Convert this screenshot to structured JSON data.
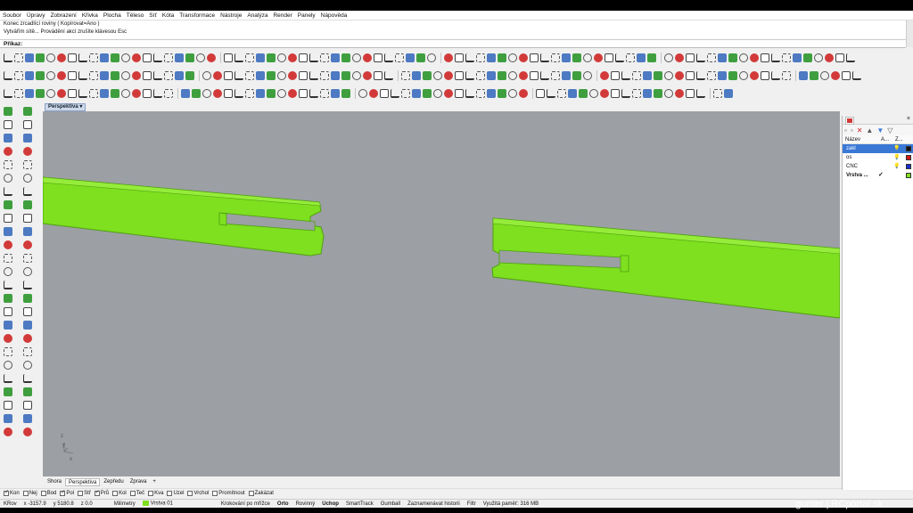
{
  "menu": [
    "Soubor",
    "Úpravy",
    "Zobrazení",
    "Křivka",
    "Plocha",
    "Těleso",
    "Síť",
    "Kóta",
    "Transformace",
    "Nástroje",
    "Analýza",
    "Render",
    "Panely",
    "Nápověda"
  ],
  "command_history": [
    "Konec zrcadlící roviny ( Kopírovat=Ano )",
    "Vytvářím sítě... Provádění akcí zrušíte klávesou Esc"
  ],
  "command_prompt": "Příkaz:",
  "viewport": {
    "active_tab": "Perspektiva",
    "bottom_tabs": [
      "Shora",
      "Perspektiva",
      "Zepředu",
      "Zprava"
    ],
    "active_bottom_tab": "Perspektiva",
    "add_tab": "+",
    "background_color": "#9c9fa4",
    "object_color": "#7ee01f",
    "axis_labels": {
      "x": "x",
      "y": "y",
      "z": "z"
    }
  },
  "osnap": [
    {
      "label": "Kon",
      "checked": true
    },
    {
      "label": "Nej",
      "checked": false
    },
    {
      "label": "Bod",
      "checked": false
    },
    {
      "label": "Pol",
      "checked": true
    },
    {
      "label": "Stř",
      "checked": false
    },
    {
      "label": "Prů",
      "checked": true
    },
    {
      "label": "Kol",
      "checked": false
    },
    {
      "label": "Teč",
      "checked": false
    },
    {
      "label": "Kva",
      "checked": false
    },
    {
      "label": "Uzel",
      "checked": false
    },
    {
      "label": "Vrchol",
      "checked": false
    },
    {
      "label": "Promítnout",
      "checked": false
    },
    {
      "label": "Zakázat",
      "checked": false
    }
  ],
  "status": {
    "cplane": "KRov",
    "x": "x -3157.9",
    "y": "y 5180.8",
    "z": "z 0.0",
    "units": "Milimetry",
    "layer": "Vrstva 01",
    "layer_color": "#7ee01f",
    "grid_snap": "Krokování po mřížce",
    "ortho": "Orto",
    "planar": "Rovinný",
    "osnap": "Uchop",
    "smarttrack": "SmartTrack",
    "gumball": "Gumball",
    "history": "Zaznamenávat historii",
    "filter": "Filtr",
    "memory": "Využitá paměť: 316 MB"
  },
  "layers_panel": {
    "columns": [
      "Název",
      "A...",
      "Z..."
    ],
    "layers": [
      {
        "name": "zakl",
        "color": "#111111",
        "selected": true,
        "current": false
      },
      {
        "name": "os",
        "color": "#d01818",
        "selected": false,
        "current": false
      },
      {
        "name": "CNC",
        "color": "#1830c8",
        "selected": false,
        "current": false
      },
      {
        "name": "Vrstva ...",
        "color": "#7ee01f",
        "selected": false,
        "current": true
      }
    ],
    "check_mark": "✓",
    "bulb": "💡"
  },
  "watermark": "gunter | RCportal.sk"
}
